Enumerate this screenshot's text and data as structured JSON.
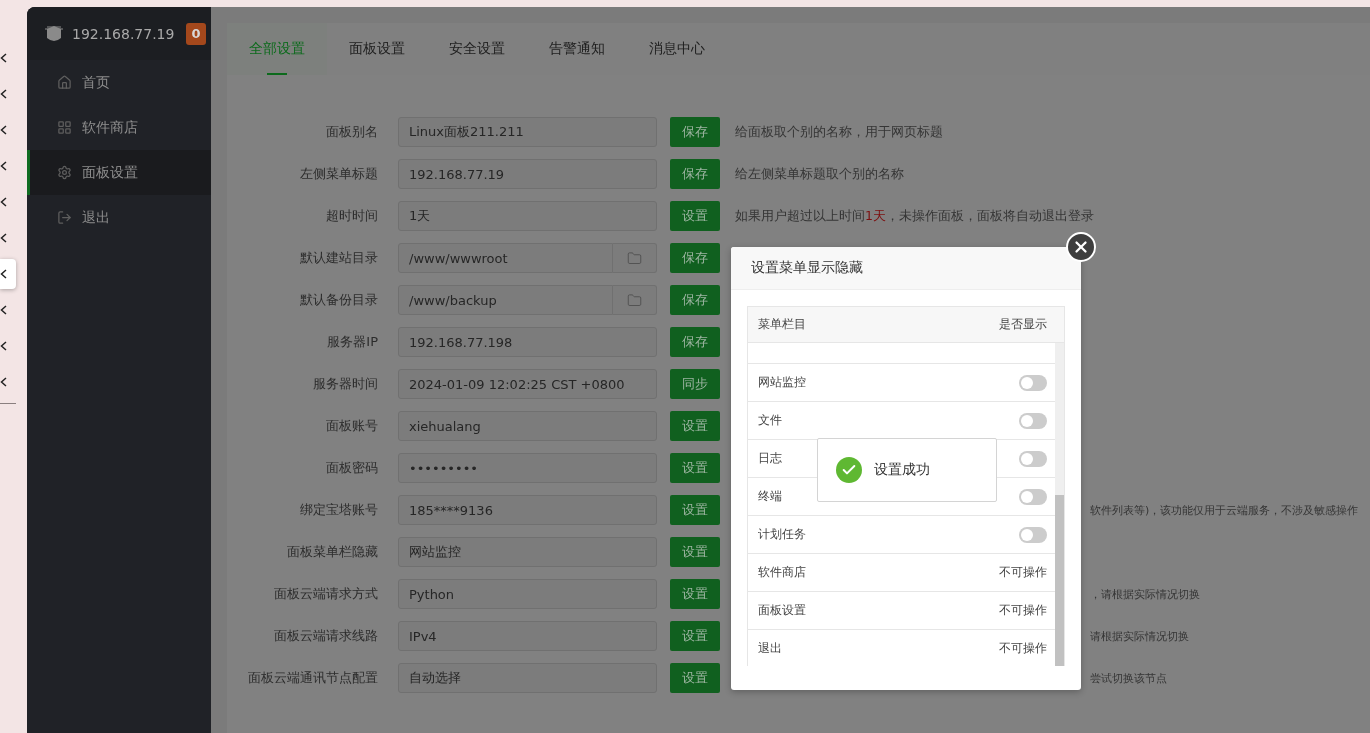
{
  "left_strip": {
    "items": [
      {
        "selected": false
      },
      {
        "selected": false
      },
      {
        "selected": false
      },
      {
        "selected": false
      },
      {
        "selected": false
      },
      {
        "selected": false
      },
      {
        "selected": true
      },
      {
        "selected": false
      },
      {
        "selected": false
      },
      {
        "selected": false
      }
    ]
  },
  "sidebar": {
    "title": "192.168.77.19",
    "badge": "0",
    "items": [
      {
        "label": "首页",
        "selected": false
      },
      {
        "label": "软件商店",
        "selected": false
      },
      {
        "label": "面板设置",
        "selected": true
      },
      {
        "label": "退出",
        "selected": false
      }
    ]
  },
  "tabs": [
    {
      "label": "全部设置",
      "selected": true
    },
    {
      "label": "面板设置",
      "selected": false
    },
    {
      "label": "安全设置",
      "selected": false
    },
    {
      "label": "告警通知",
      "selected": false
    },
    {
      "label": "消息中心",
      "selected": false
    }
  ],
  "settings": [
    {
      "label": "面板别名",
      "value": "Linux面板211.211",
      "kind": "text",
      "button": "保存",
      "description": {
        "kind": "full",
        "parts": [
          {
            "text": "给面板取个别的名称，用于网页标题",
            "highlight": false
          }
        ]
      }
    },
    {
      "label": "左侧菜单标题",
      "value": "192.168.77.19",
      "kind": "text",
      "button": "保存",
      "description": {
        "kind": "full",
        "parts": [
          {
            "text": "给左侧菜单标题取个别的名称",
            "highlight": false
          }
        ]
      }
    },
    {
      "label": "超时时间",
      "value": "1天",
      "kind": "text",
      "button": "设置",
      "description": {
        "kind": "full",
        "parts": [
          {
            "text": "如果用户超过以上时间",
            "highlight": false
          },
          {
            "text": "1天",
            "highlight": true
          },
          {
            "text": "，未操作面板，面板将自动退出登录",
            "highlight": false
          }
        ]
      }
    },
    {
      "label": "默认建站目录",
      "value": "/www/wwwroot",
      "kind": "folder",
      "button": "保存"
    },
    {
      "label": "默认备份目录",
      "value": "/www/backup",
      "kind": "folder",
      "button": "保存"
    },
    {
      "label": "服务器IP",
      "value": "192.168.77.198",
      "kind": "text",
      "button": "保存"
    },
    {
      "label": "服务器时间",
      "value": "2024-01-09 12:02:25 CST +0800",
      "kind": "text",
      "button": "同步"
    },
    {
      "label": "面板账号",
      "value": "xiehualang",
      "kind": "text",
      "button": "设置"
    },
    {
      "label": "面板密码",
      "value": "•••••••••",
      "kind": "text",
      "button": "设置"
    },
    {
      "label": "绑定宝塔账号",
      "value": "185****9136",
      "kind": "text",
      "button": "设置",
      "description": {
        "kind": "partial",
        "parts": [
          {
            "text": "软件列表等)，该功能仅用于云端服务，不涉及敏感操作",
            "highlight": false
          }
        ]
      }
    },
    {
      "label": "面板菜单栏隐藏",
      "value": "网站监控",
      "kind": "text",
      "button": "设置"
    },
    {
      "label": "面板云端请求方式",
      "value": "Python",
      "kind": "text",
      "button": "设置",
      "description": {
        "kind": "partial",
        "parts": [
          {
            "text": "，请根据实际情况切换",
            "highlight": false
          }
        ]
      }
    },
    {
      "label": "面板云端请求线路",
      "value": "IPv4",
      "kind": "text",
      "button": "设置",
      "description": {
        "kind": "partial",
        "parts": [
          {
            "text": "请根据实际情况切换",
            "highlight": false
          }
        ]
      }
    },
    {
      "label": "面板云端通讯节点配置",
      "value": "自动选择",
      "kind": "text",
      "button": "设置",
      "description": {
        "kind": "partial",
        "parts": [
          {
            "text": "尝试切换该节点",
            "highlight": false
          }
        ]
      }
    }
  ],
  "dialog": {
    "title": "设置菜单显示隐藏",
    "columns": [
      "菜单栏目",
      "是否显示"
    ],
    "rows": [
      {
        "name": "网站监控",
        "kind": "toggle",
        "on": false
      },
      {
        "name": "文件",
        "kind": "toggle",
        "on": false
      },
      {
        "name": "日志",
        "kind": "toggle",
        "on": false
      },
      {
        "name": "终端",
        "kind": "toggle",
        "on": false
      },
      {
        "name": "计划任务",
        "kind": "toggle",
        "on": false
      },
      {
        "name": "软件商店",
        "kind": "locked",
        "status": "不可操作"
      },
      {
        "name": "面板设置",
        "kind": "locked",
        "status": "不可操作"
      },
      {
        "name": "退出",
        "kind": "locked",
        "status": "不可操作"
      }
    ]
  },
  "toast": {
    "message": "设置成功"
  }
}
